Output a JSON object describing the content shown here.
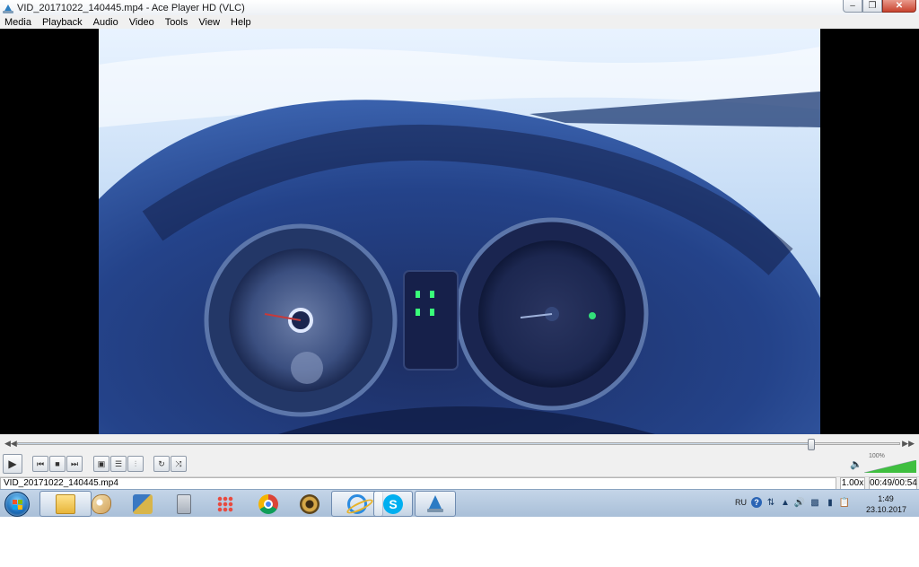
{
  "window": {
    "title": "VID_20171022_140445.mp4 - Ace Player HD (VLC)",
    "minimize": "–",
    "restore": "❐",
    "close": "✕"
  },
  "menu": [
    "Media",
    "Playback",
    "Audio",
    "Video",
    "Tools",
    "View",
    "Help"
  ],
  "seek": {
    "position": 0.9,
    "back": "◀◀",
    "forward": "▶▶"
  },
  "controls": {
    "play": "▶",
    "prev": "⏮",
    "stop": "■",
    "next": "⏭",
    "fullscreen": "▣",
    "playlist": "☰",
    "equalizer": "⫶",
    "loop": "↻",
    "shuffle": "⤨"
  },
  "volume": {
    "label": "100%",
    "level": 1.0,
    "icon": "speaker-icon"
  },
  "status": {
    "filename": "VID_20171022_140445.mp4",
    "speed": "1.00x",
    "time": "00:49/00:54"
  },
  "taskbar": {
    "apps": [
      {
        "name": "explorer",
        "icon": "folder-icon",
        "active": true
      },
      {
        "name": "paint",
        "icon": "palette-icon",
        "active": false
      },
      {
        "name": "tools",
        "icon": "tools-icon",
        "active": false
      },
      {
        "name": "calculator",
        "icon": "calculator-icon",
        "active": false
      },
      {
        "name": "apps",
        "icon": "grid-icon",
        "active": false
      },
      {
        "name": "chrome",
        "icon": "chrome-icon",
        "active": false
      },
      {
        "name": "eye",
        "icon": "eye-icon",
        "active": false
      },
      {
        "name": "ie",
        "icon": "ie-icon",
        "active": true
      },
      {
        "name": "skype",
        "icon": "skype-icon",
        "active": true,
        "glyph": "S"
      },
      {
        "name": "vlc",
        "icon": "vlc-icon",
        "active": true
      }
    ],
    "tray": {
      "lang": "RU",
      "help": "?",
      "time": "1:49",
      "date": "23.10.2017"
    }
  },
  "colors": {
    "chrome_bg": "#f0f0f0",
    "taskbar": "#b4c8de",
    "accent": "#2b7bc4"
  }
}
